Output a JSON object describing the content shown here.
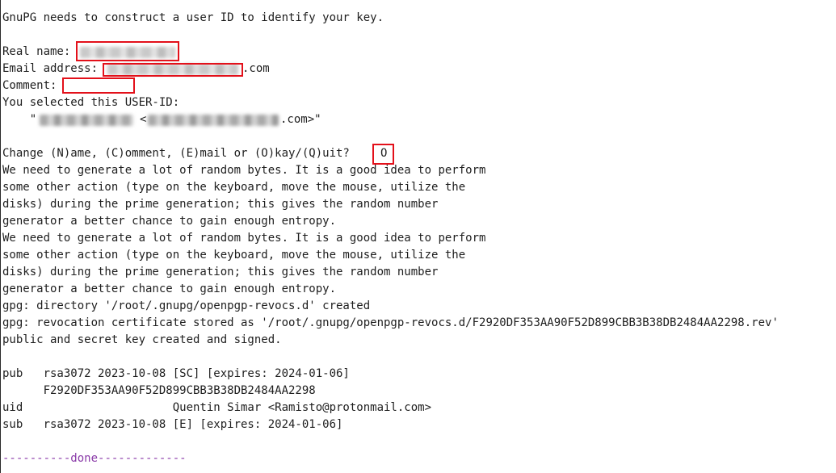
{
  "terminal": {
    "intro": "GnuPG needs to construct a user ID to identify your key.",
    "real_name_label": "Real name: ",
    "email_label": "Email address: ",
    "email_suffix": ".com",
    "comment_label": "Comment: ",
    "selected_label": "You selected this USER-ID:",
    "uid_quote_open": "    \"",
    "uid_email_open": "<",
    "uid_suffix": ".com>\"",
    "change_prompt": "Change (N)ame, (C)omment, (E)mail or (O)kay/(Q)uit? ",
    "change_answer": "O",
    "entropy_block_1": [
      "We need to generate a lot of random bytes. It is a good idea to perform",
      "some other action (type on the keyboard, move the mouse, utilize the",
      "disks) during the prime generation; this gives the random number",
      "generator a better chance to gain enough entropy."
    ],
    "entropy_block_2": [
      "We need to generate a lot of random bytes. It is a good idea to perform",
      "some other action (type on the keyboard, move the mouse, utilize the",
      "disks) during the prime generation; this gives the random number",
      "generator a better chance to gain enough entropy."
    ],
    "gpg_directory": "gpg: directory '/root/.gnupg/openpgp-revocs.d' created",
    "gpg_revocation": "gpg: revocation certificate stored as '/root/.gnupg/openpgp-revocs.d/F2920DF353AA90F52D899CBB3B38DB2484AA2298.rev'",
    "key_created": "public and secret key created and signed.",
    "pub_line": "pub   rsa3072 2023-10-08 [SC] [expires: 2024-01-06]",
    "fingerprint_line": "      F2920DF353AA90F52D899CBB3B38DB2484AA2298",
    "uid_line": "uid                      Quentin Simar <Ramisto@protonmail.com>",
    "sub_line": "sub   rsa3072 2023-10-08 [E] [expires: 2024-01-06]",
    "done_left": "----------",
    "done_word": "done",
    "done_right": "-------------"
  }
}
